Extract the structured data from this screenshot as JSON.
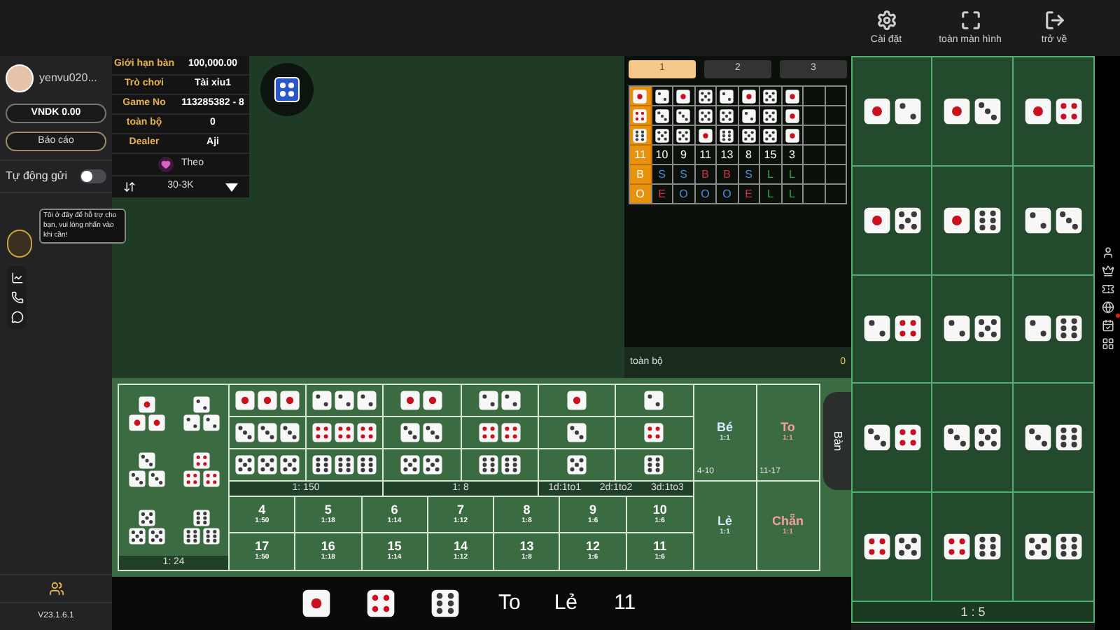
{
  "toolbar": [
    {
      "kind": "settings",
      "label": "Cài đặt"
    },
    {
      "kind": "fullscreen",
      "label": "toàn màn hình"
    },
    {
      "kind": "exit",
      "label": "trở về"
    }
  ],
  "sidebar": {
    "username": "yenvu020...",
    "balance_button": "VNDK 0.00",
    "report_button": "Báo cáo",
    "auto_send": {
      "label": "Tự động gửi",
      "on": false
    },
    "support_tooltip": "Tôi ở đây để hỗ trợ cho bạn, vui lòng nhấn vào khi cần!",
    "version": "V23.1.6.1"
  },
  "table_info": {
    "rows": [
      {
        "label": "Giới hạn bàn",
        "value": "100,000.00"
      },
      {
        "label": "Trò chơi",
        "value": "Tài xỉu1"
      },
      {
        "label": "Game No",
        "value": "113285382 - 8"
      },
      {
        "label": "toàn bộ",
        "value": "0"
      },
      {
        "label": "Dealer",
        "value": "Aji"
      }
    ],
    "follow_label": "Theo",
    "bet_range": "30-3K"
  },
  "scoreboard": {
    "tabs": [
      {
        "label": "1",
        "selected": true
      },
      {
        "label": "2",
        "selected": false
      },
      {
        "label": "3",
        "selected": false
      }
    ],
    "legend": {
      "dice": [
        {
          "kind": "one"
        },
        {
          "kind": "four"
        },
        {
          "kind": "six"
        }
      ],
      "sum": "11",
      "size": "B",
      "parity": "O"
    },
    "results": [
      {
        "dice": [
          {
            "kind": "two"
          },
          {
            "kind": "three"
          },
          {
            "kind": "five"
          }
        ],
        "sum": "10",
        "size": {
          "text": "S",
          "color": "#4a8fe0"
        },
        "parity": {
          "text": "E",
          "color": "#d0314a"
        }
      },
      {
        "dice": [
          {
            "kind": "one"
          },
          {
            "kind": "three"
          },
          {
            "kind": "five"
          }
        ],
        "sum": "9",
        "size": {
          "text": "S",
          "color": "#4a8fe0"
        },
        "parity": {
          "text": "O",
          "color": "#4a8fe0"
        }
      },
      {
        "dice": [
          {
            "kind": "five"
          },
          {
            "kind": "five"
          },
          {
            "kind": "one"
          }
        ],
        "sum": "11",
        "size": {
          "text": "B",
          "color": "#d0314a"
        },
        "parity": {
          "text": "O",
          "color": "#4a8fe0"
        }
      },
      {
        "dice": [
          {
            "kind": "two"
          },
          {
            "kind": "five"
          },
          {
            "kind": "six"
          }
        ],
        "sum": "13",
        "size": {
          "text": "B",
          "color": "#d0314a"
        },
        "parity": {
          "text": "O",
          "color": "#4a8fe0"
        }
      },
      {
        "dice": [
          {
            "kind": "one"
          },
          {
            "kind": "two"
          },
          {
            "kind": "five"
          }
        ],
        "sum": "8",
        "size": {
          "text": "S",
          "color": "#4a8fe0"
        },
        "parity": {
          "text": "E",
          "color": "#d0314a"
        }
      },
      {
        "dice": [
          {
            "kind": "five"
          },
          {
            "kind": "five"
          },
          {
            "kind": "five"
          }
        ],
        "sum": "15",
        "size": {
          "text": "L",
          "color": "#3aa54a"
        },
        "parity": {
          "text": "L",
          "color": "#3aa54a"
        }
      },
      {
        "dice": [
          {
            "kind": "one"
          },
          {
            "kind": "one"
          },
          {
            "kind": "one"
          }
        ],
        "sum": "3",
        "size": {
          "text": "L",
          "color": "#3aa54a"
        },
        "parity": {
          "text": "L",
          "color": "#3aa54a"
        }
      }
    ],
    "total_label": "toàn bộ",
    "total": "0"
  },
  "bet_table": {
    "any_triple": {
      "groups": [
        {
          "kind": "one"
        },
        {
          "kind": "two"
        },
        {
          "kind": "three"
        },
        {
          "kind": "four"
        },
        {
          "kind": "five"
        },
        {
          "kind": "six"
        }
      ],
      "payout": "1: 24"
    },
    "triples": {
      "cells": [
        {
          "kind": "one"
        },
        {
          "kind": "two"
        },
        {
          "kind": "three"
        },
        {
          "kind": "four"
        },
        {
          "kind": "five"
        },
        {
          "kind": "six"
        }
      ],
      "payout": "1: 150"
    },
    "doubles": {
      "cells": [
        {
          "kind": "one"
        },
        {
          "kind": "two"
        },
        {
          "kind": "three"
        },
        {
          "kind": "four"
        },
        {
          "kind": "five"
        },
        {
          "kind": "six"
        }
      ],
      "payout": "1: 8"
    },
    "singles": {
      "cells": [
        {
          "kind": "one"
        },
        {
          "kind": "two"
        },
        {
          "kind": "three"
        },
        {
          "kind": "four"
        },
        {
          "kind": "five"
        },
        {
          "kind": "six"
        }
      ],
      "payouts": [
        "1d:1to1",
        "2d:1to2",
        "3d:1to3"
      ]
    },
    "sums": [
      {
        "total": "4",
        "payout": "1:50"
      },
      {
        "total": "5",
        "payout": "1:18"
      },
      {
        "total": "6",
        "payout": "1:14"
      },
      {
        "total": "7",
        "payout": "1:12"
      },
      {
        "total": "8",
        "payout": "1:8"
      },
      {
        "total": "9",
        "payout": "1:6"
      },
      {
        "total": "10",
        "payout": "1:6"
      },
      {
        "total": "17",
        "payout": "1:50"
      },
      {
        "total": "16",
        "payout": "1:18"
      },
      {
        "total": "15",
        "payout": "1:14"
      },
      {
        "total": "14",
        "payout": "1:12"
      },
      {
        "total": "13",
        "payout": "1:8"
      },
      {
        "total": "12",
        "payout": "1:6"
      },
      {
        "total": "11",
        "payout": "1:6"
      }
    ],
    "outcomes": [
      {
        "label": "Bé",
        "payout": "1:1",
        "range": "4-10",
        "color": "#dbe9ff"
      },
      {
        "label": "To",
        "payout": "1:1",
        "range": "11-17",
        "color": "#f2a0a0"
      },
      {
        "label": "Lẻ",
        "payout": "1:1",
        "color": "#dbe9ff"
      },
      {
        "label": "Chẵn",
        "payout": "1:1",
        "color": "#f2a0a0"
      }
    ],
    "side_tab": "Bàn"
  },
  "pair_bets": {
    "cells": [
      {
        "dice": [
          {
            "kind": "one"
          },
          {
            "kind": "two"
          }
        ]
      },
      {
        "dice": [
          {
            "kind": "one"
          },
          {
            "kind": "three"
          }
        ]
      },
      {
        "dice": [
          {
            "kind": "one"
          },
          {
            "kind": "four"
          }
        ]
      },
      {
        "dice": [
          {
            "kind": "one"
          },
          {
            "kind": "five"
          }
        ]
      },
      {
        "dice": [
          {
            "kind": "one"
          },
          {
            "kind": "six"
          }
        ]
      },
      {
        "dice": [
          {
            "kind": "two"
          },
          {
            "kind": "three"
          }
        ]
      },
      {
        "dice": [
          {
            "kind": "two"
          },
          {
            "kind": "four"
          }
        ]
      },
      {
        "dice": [
          {
            "kind": "two"
          },
          {
            "kind": "five"
          }
        ]
      },
      {
        "dice": [
          {
            "kind": "two"
          },
          {
            "kind": "six"
          }
        ]
      },
      {
        "dice": [
          {
            "kind": "three"
          },
          {
            "kind": "four"
          }
        ]
      },
      {
        "dice": [
          {
            "kind": "three"
          },
          {
            "kind": "five"
          }
        ]
      },
      {
        "dice": [
          {
            "kind": "three"
          },
          {
            "kind": "six"
          }
        ]
      },
      {
        "dice": [
          {
            "kind": "four"
          },
          {
            "kind": "five"
          }
        ]
      },
      {
        "dice": [
          {
            "kind": "four"
          },
          {
            "kind": "six"
          }
        ]
      },
      {
        "dice": [
          {
            "kind": "five"
          },
          {
            "kind": "six"
          }
        ]
      }
    ],
    "payout": "1 : 5"
  },
  "result_bar": {
    "dice": [
      {
        "kind": "one"
      },
      {
        "kind": "four"
      },
      {
        "kind": "six"
      }
    ],
    "size": "To",
    "parity": "Lẻ",
    "sum": "11"
  }
}
